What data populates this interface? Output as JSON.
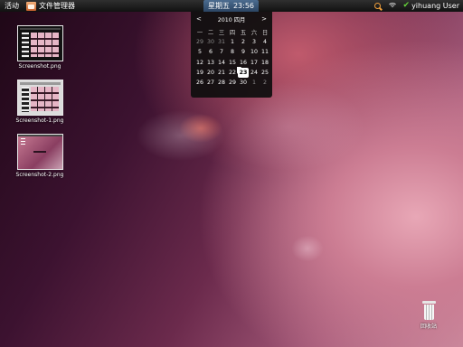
{
  "topbar": {
    "activities": "活动",
    "app_name": "文件管理器",
    "app_icon": "file-manager-icon",
    "clock_day": "星期五",
    "clock_time": "23:56",
    "user_name": "yihuang User",
    "icons": [
      "search-icon",
      "wifi-icon",
      "check-icon"
    ]
  },
  "calendar": {
    "prev": "<",
    "next": ">",
    "month_label": "2010 四月",
    "weekdays": [
      "一",
      "二",
      "三",
      "四",
      "五",
      "六",
      "日"
    ],
    "weeks": [
      [
        "29",
        "30",
        "31",
        "1",
        "2",
        "3",
        "4"
      ],
      [
        "5",
        "6",
        "7",
        "8",
        "9",
        "10",
        "11"
      ],
      [
        "12",
        "13",
        "14",
        "15",
        "16",
        "17",
        "18"
      ],
      [
        "19",
        "20",
        "21",
        "22",
        "23",
        "24",
        "25"
      ],
      [
        "26",
        "27",
        "28",
        "29",
        "30",
        "1",
        "2"
      ]
    ],
    "today": "23"
  },
  "desktop": {
    "files": [
      {
        "name": "Screenshot.png"
      },
      {
        "name": "Screenshot-1.png"
      },
      {
        "name": "Screenshot-2.png"
      }
    ],
    "trash_label": "回收站"
  },
  "colors": {
    "panel": "#1c1c1c",
    "clock_bg": "#3a5678",
    "search_icon": "#f2a03c",
    "check_icon": "#64d23a"
  }
}
